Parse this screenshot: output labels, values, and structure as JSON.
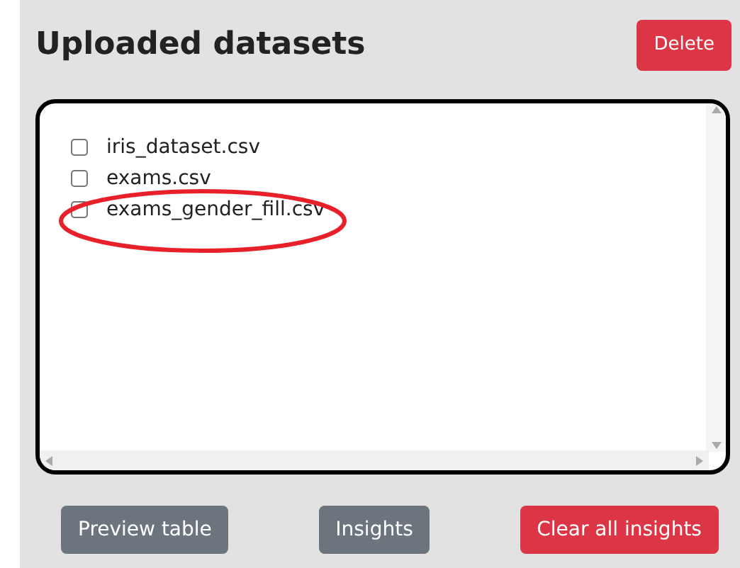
{
  "title": "Uploaded datasets",
  "delete_button": {
    "label": "Delete"
  },
  "datasets": [
    {
      "name": "iris_dataset.csv",
      "checked": false
    },
    {
      "name": "exams.csv",
      "checked": false
    },
    {
      "name": "exams_gender_fill.csv",
      "checked": false
    }
  ],
  "buttons": [
    {
      "label": "Preview table",
      "kind": "secondary"
    },
    {
      "label": "Insights",
      "kind": "secondary"
    },
    {
      "label": "Clear all insights",
      "kind": "danger"
    }
  ]
}
